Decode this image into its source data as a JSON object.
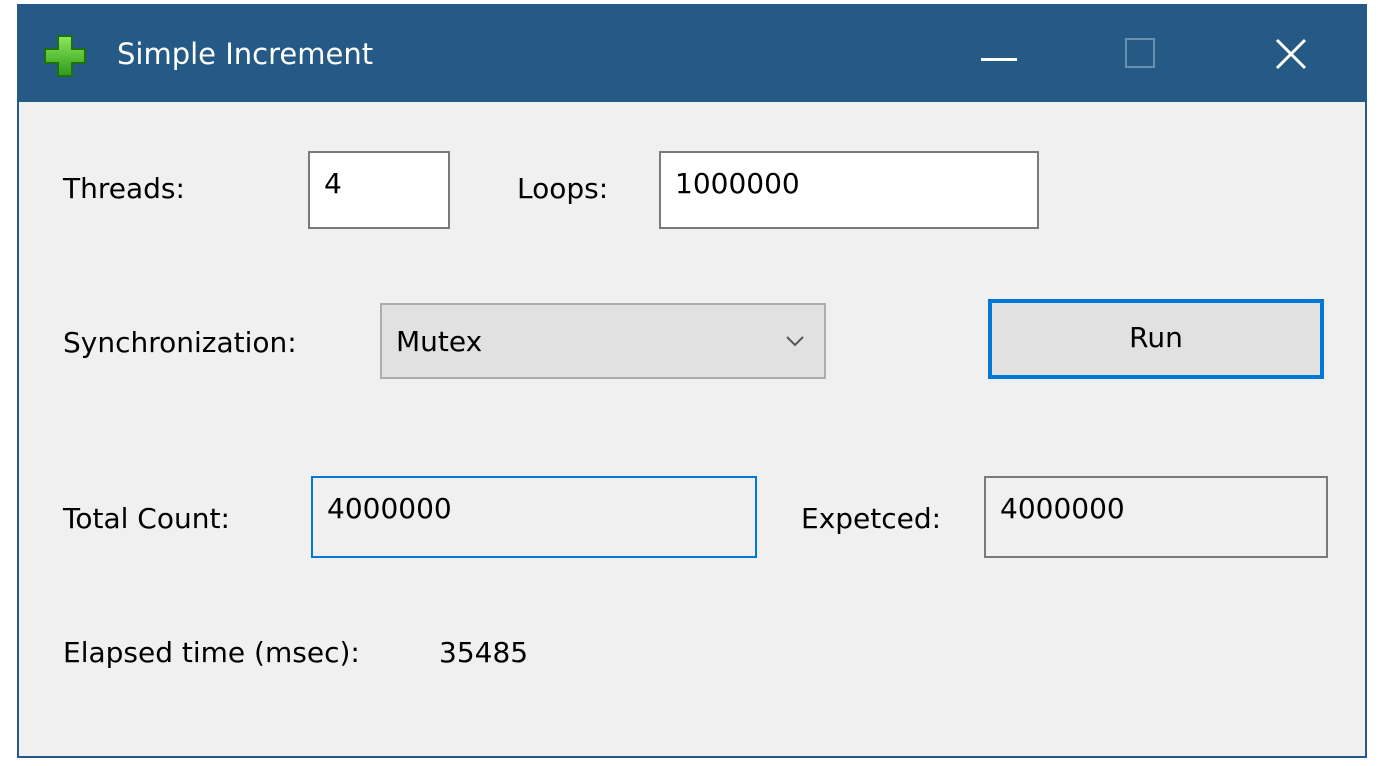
{
  "window": {
    "title": "Simple Increment",
    "titlebar_color": "#245a85",
    "accent_color": "#0078d7",
    "controls": [
      "minimize-icon",
      "maximize-icon",
      "close-icon"
    ]
  },
  "form": {
    "threads_label": "Threads:",
    "threads_value": "4",
    "loops_label": "Loops:",
    "loops_value": "1000000",
    "sync_label": "Synchronization:",
    "sync_selected": "Mutex",
    "run_label": "Run",
    "total_label": "Total Count:",
    "total_value": "4000000",
    "expected_label": "Expetced:",
    "expected_value": "4000000",
    "elapsed_label": "Elapsed time (msec):",
    "elapsed_value": "35485"
  }
}
